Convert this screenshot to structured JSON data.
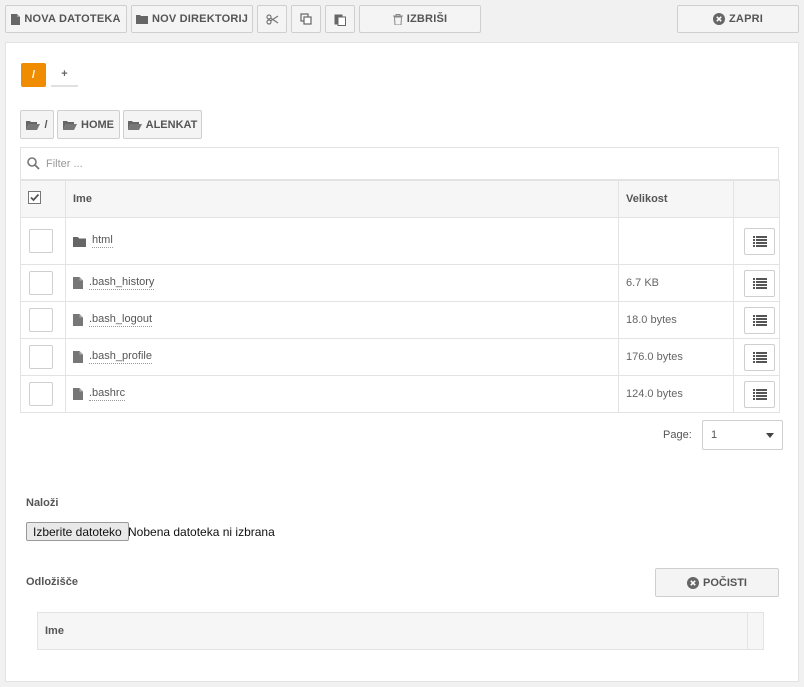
{
  "toolbar": {
    "new_file_label": "NOVA DATOTEKA",
    "new_dir_label": "NOV DIREKTORIJ",
    "cut_icon": "scissors-icon",
    "copy_icon": "copy-icon",
    "paste_icon": "paste-icon",
    "delete_label": "IZBRIŠI",
    "close_label": "ZAPRI"
  },
  "tabs": [
    {
      "label": "/",
      "active": true
    },
    {
      "label": "+",
      "active": false
    }
  ],
  "breadcrumb": [
    "/",
    "HOME",
    "ALENKAT"
  ],
  "filter": {
    "placeholder": "Filter ..."
  },
  "table": {
    "columns": {
      "name": "Ime",
      "size": "Velikost"
    },
    "rows": [
      {
        "type": "folder",
        "name": "html",
        "size": ""
      },
      {
        "type": "file",
        "name": ".bash_history",
        "size": "6.7 KB"
      },
      {
        "type": "file",
        "name": ".bash_logout",
        "size": "18.0 bytes"
      },
      {
        "type": "file",
        "name": ".bash_profile",
        "size": "176.0 bytes"
      },
      {
        "type": "file",
        "name": ".bashrc",
        "size": "124.0 bytes"
      }
    ]
  },
  "pagination": {
    "label": "Page:",
    "value": "1"
  },
  "upload": {
    "title": "Naloži",
    "button_label": "Izberite datoteko",
    "status": "Nobena datoteka ni izbrana"
  },
  "clipboard": {
    "title": "Odložišče",
    "clear_label": "POČISTI",
    "column_name": "Ime"
  },
  "colors": {
    "accent": "#f08c00",
    "border": "#cfcfcf",
    "header_bg": "#f6f6f6"
  }
}
